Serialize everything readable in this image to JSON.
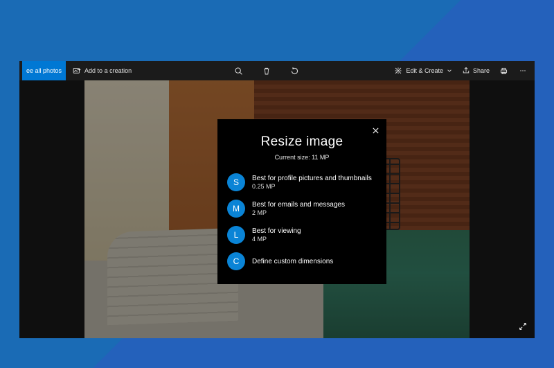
{
  "toolbar": {
    "see_all_label": "ee all photos",
    "add_label": "Add to a creation",
    "edit_create_label": "Edit & Create",
    "share_label": "Share"
  },
  "dialog": {
    "title": "Resize image",
    "subtitle": "Current size: 11 MP",
    "options": [
      {
        "badge": "S",
        "primary": "Best for profile pictures and thumbnails",
        "secondary": "0.25 MP"
      },
      {
        "badge": "M",
        "primary": "Best for emails and messages",
        "secondary": "2 MP"
      },
      {
        "badge": "L",
        "primary": "Best for viewing",
        "secondary": "4 MP"
      },
      {
        "badge": "C",
        "primary": "Define custom dimensions",
        "secondary": ""
      }
    ]
  },
  "colors": {
    "accent": "#0a84d6"
  }
}
